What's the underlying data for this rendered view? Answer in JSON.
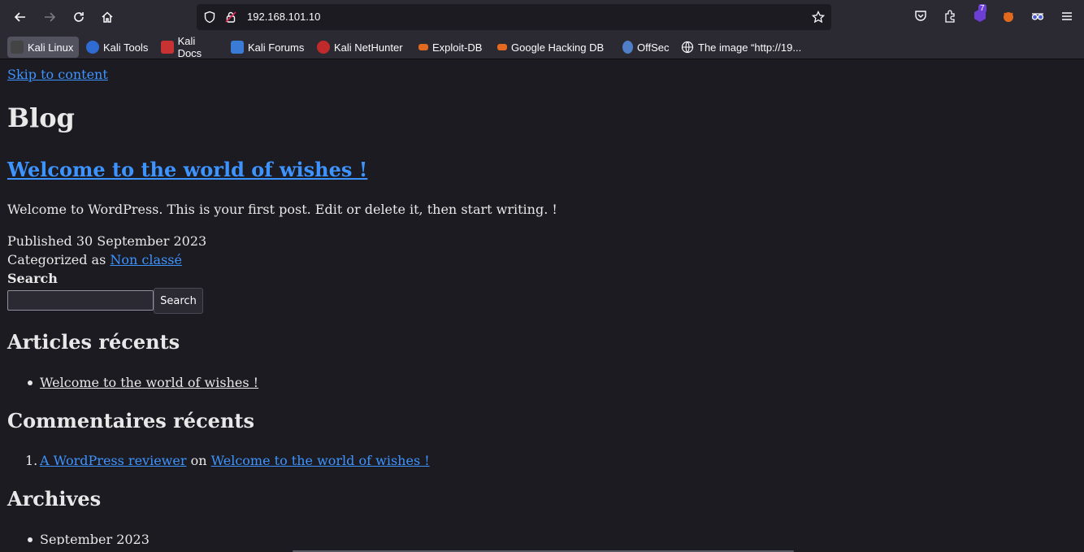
{
  "browser": {
    "url": "192.168.101.10",
    "extension_badge": "7",
    "bookmarks": [
      {
        "label": "Kali Linux",
        "color": "#6a6a6a"
      },
      {
        "label": "Kali Tools",
        "color": "#2f6bd3"
      },
      {
        "label": "Kali Docs",
        "color": "#c83232"
      },
      {
        "label": "Kali Forums",
        "color": "#3a7bd5"
      },
      {
        "label": "Kali NetHunter",
        "color": "#c02a2a"
      },
      {
        "label": "Exploit-DB",
        "color": "#e2691e"
      },
      {
        "label": "Google Hacking DB",
        "color": "#e2691e"
      },
      {
        "label": "OffSec",
        "color": "#4f7fc8"
      },
      {
        "label": "The image “http://19...",
        "color": "#bbbbbb"
      }
    ]
  },
  "page": {
    "skip_link": "Skip to content",
    "site_title": "Blog",
    "post": {
      "title": "Welcome to the world of wishes !",
      "excerpt": "Welcome to WordPress. This is your first post. Edit or delete it, then start writing. !",
      "published": "Published 30 September 2023",
      "categorized_prefix": "Categorized as",
      "category": "Non classé"
    },
    "search": {
      "label": "Search",
      "value": "",
      "button": "Search"
    },
    "recent_posts": {
      "heading": "Articles récents",
      "items": [
        "Welcome to the world of wishes !"
      ]
    },
    "recent_comments": {
      "heading": "Commentaires récents",
      "author": "A WordPress reviewer",
      "on": "on",
      "post": "Welcome to the world of wishes !",
      "number": "1."
    },
    "archives": {
      "heading": "Archives",
      "items": [
        "September 2023"
      ]
    }
  }
}
